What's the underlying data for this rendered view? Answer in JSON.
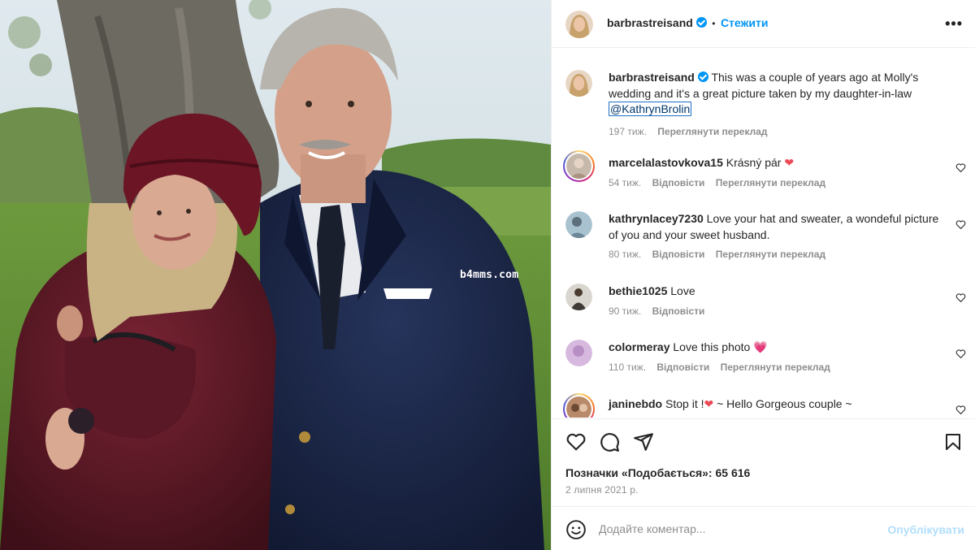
{
  "photo": {
    "watermark": "b4mms.com"
  },
  "header": {
    "username": "barbrastreisand",
    "separator": "•",
    "follow_label": "Стежити",
    "more_label": "•••"
  },
  "caption": {
    "username": "barbrastreisand",
    "text": "This was a couple of years ago at Molly's wedding and it's a great picture taken by my daughter-in-law",
    "mention": "@KathrynBrolin",
    "time": "197 тиж.",
    "translate_label": "Переглянути переклад"
  },
  "comments": [
    {
      "username": "marcelalastovkova15",
      "text": "Krásný pár",
      "emoji": "❤",
      "time": "54 тиж.",
      "reply": "Відповісти",
      "translate": "Переглянути переклад"
    },
    {
      "username": "kathrynlacey7230",
      "text": "Love your hat and sweater, a wondeful picture of you and your sweet husband.",
      "time": "80 тиж.",
      "reply": "Відповісти",
      "translate": "Переглянути переклад"
    },
    {
      "username": "bethie1025",
      "text": "Love",
      "time": "90 тиж.",
      "reply": "Відповісти"
    },
    {
      "username": "colormeray",
      "text": "Love this photo",
      "emoji": "💗",
      "time": "110 тиж.",
      "reply": "Відповісти",
      "translate": "Переглянути переклад"
    },
    {
      "username": "janinebdo",
      "text_before": "Stop it !",
      "emoji": "❤",
      "text_after": " ~ Hello Gorgeous couple ~"
    }
  ],
  "actions": {
    "likes": "Позначки «Подобається»: 65 616",
    "date": "2 липня 2021 р."
  },
  "add_comment": {
    "placeholder": "Додайте коментар...",
    "publish_label": "Опублікувати"
  },
  "icons": [
    "heart-icon",
    "comment-icon",
    "share-icon",
    "bookmark-icon",
    "emoji-icon",
    "more-icon",
    "verified-icon"
  ],
  "colors": {
    "accent": "#0095f6",
    "heart": "#ed4956",
    "publish_disabled": "#b2dffc"
  }
}
